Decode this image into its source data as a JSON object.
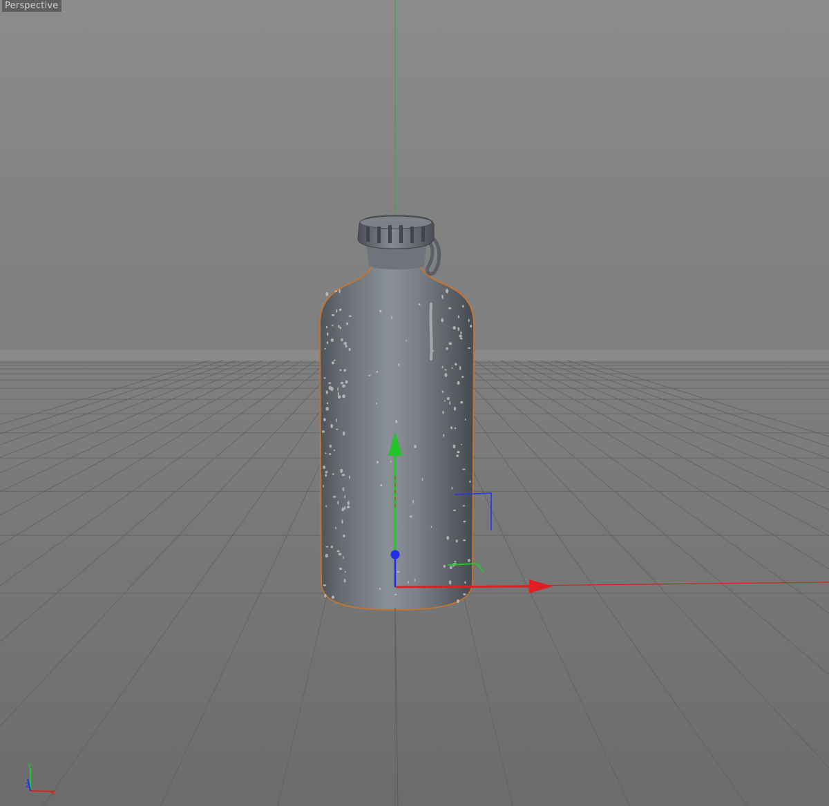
{
  "viewport": {
    "label": "Perspective"
  },
  "scene_object": {
    "name": "bottle",
    "shading_color": "#6d7278",
    "selection_outline_color": "#d07a2a"
  },
  "colors": {
    "background_top": "#858585",
    "background_floor": "#767676",
    "grid_line": "#5e5e5e",
    "axis_x": "#e02020",
    "axis_y": "#22c52a",
    "axis_z": "#1f2fe8"
  },
  "icons": {
    "move_gizmo": "move-manipulator-icon",
    "world_axis": "world-axis-icon"
  }
}
